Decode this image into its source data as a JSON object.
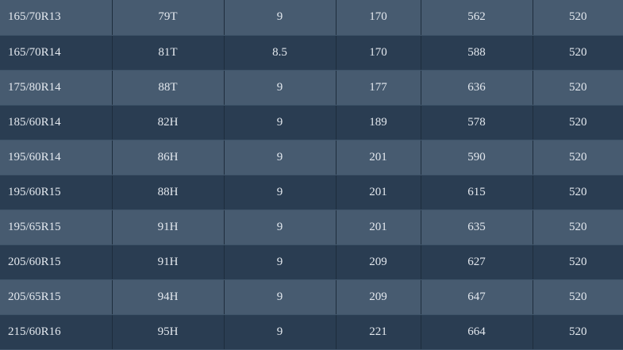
{
  "table": {
    "rows": [
      [
        "165/70R13",
        "79T",
        "9",
        "170",
        "562",
        "520"
      ],
      [
        "165/70R14",
        "81T",
        "8.5",
        "170",
        "588",
        "520"
      ],
      [
        "175/80R14",
        "88T",
        "9",
        "177",
        "636",
        "520"
      ],
      [
        "185/60R14",
        "82H",
        "9",
        "189",
        "578",
        "520"
      ],
      [
        "195/60R14",
        "86H",
        "9",
        "201",
        "590",
        "520"
      ],
      [
        "195/60R15",
        "88H",
        "9",
        "201",
        "615",
        "520"
      ],
      [
        "195/65R15",
        "91H",
        "9",
        "201",
        "635",
        "520"
      ],
      [
        "205/60R15",
        "91H",
        "9",
        "209",
        "627",
        "520"
      ],
      [
        "205/65R15",
        "94H",
        "9",
        "209",
        "647",
        "520"
      ],
      [
        "215/60R16",
        "95H",
        "9",
        "221",
        "664",
        "520"
      ]
    ],
    "colors": {
      "row_light": "#475b70",
      "row_dark": "#2a3d52",
      "text": "#e3e8ee"
    }
  }
}
